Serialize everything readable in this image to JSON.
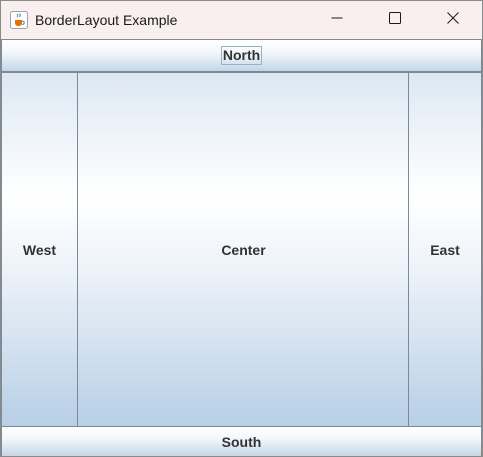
{
  "window": {
    "title": "BorderLayout Example",
    "app_icon": "java-coffee-cup-icon",
    "controls": [
      "minimize-icon",
      "maximize-icon",
      "close-icon"
    ]
  },
  "layout": {
    "north": "North",
    "west": "West",
    "center": "Center",
    "east": "East",
    "south": "South"
  },
  "colors": {
    "titlebar": "#f9efef",
    "button_border": "#7a8a99",
    "button_text": "#333333",
    "gradient_light": "#ffffff",
    "gradient_dark": "#b8cfe6"
  }
}
